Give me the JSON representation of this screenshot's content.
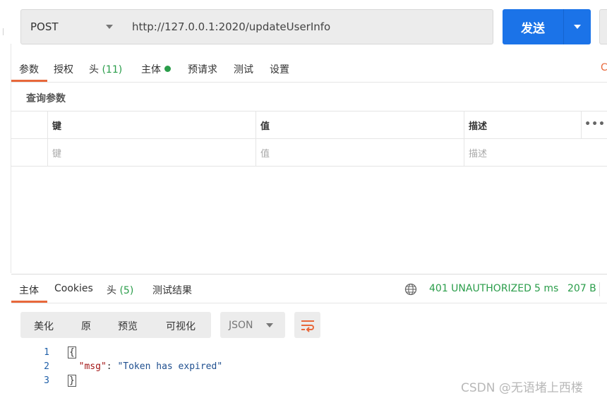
{
  "request": {
    "method": "POST",
    "url": "http://127.0.0.1:2020/updateUserInfo",
    "send_label": "发送"
  },
  "request_tabs": {
    "params": "参数",
    "auth": "授权",
    "headers": "头",
    "headers_count": "(11)",
    "body": "主体",
    "pre_request": "预请求",
    "tests": "测试",
    "settings": "设置",
    "clipped": "C"
  },
  "query_params": {
    "title": "查询参数",
    "headers": [
      "键",
      "值",
      "描述"
    ],
    "placeholders": [
      "键",
      "值",
      "描述"
    ],
    "more": "•••"
  },
  "response_tabs": {
    "body": "主体",
    "cookies": "Cookies",
    "headers": "头",
    "headers_count": "(5)",
    "test_results": "测试结果"
  },
  "response_meta": {
    "status": "401 UNAUTHORIZED",
    "time": "5 ms",
    "size": "207 B",
    "accent": "#2a9d4a"
  },
  "view_toolbar": {
    "pretty": "美化",
    "raw": "原",
    "preview": "预览",
    "visualize": "可视化",
    "format": "JSON"
  },
  "response_body": {
    "line_numbers": [
      "1",
      "2",
      "3"
    ],
    "open_brace": "{",
    "key": "\"msg\"",
    "colon": ": ",
    "value": "\"Token has expired\"",
    "close_brace": "}"
  },
  "watermark": "CSDN @无语堵上西楼",
  "colors": {
    "send_button": "#1b73e8",
    "active_tab": "#e8683b",
    "status_ok": "#2a9d4a"
  }
}
